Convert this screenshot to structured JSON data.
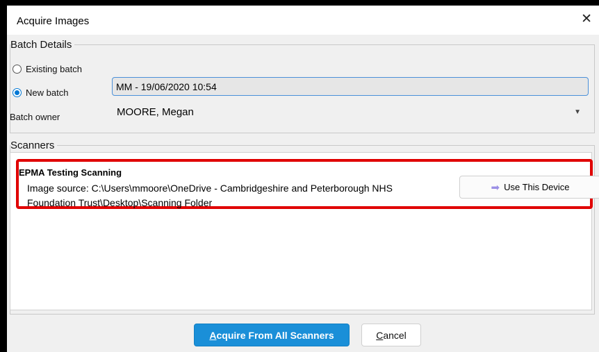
{
  "window": {
    "title": "Acquire Images",
    "close_glyph": "✕"
  },
  "batch_details": {
    "legend": "Batch Details",
    "existing_batch_label": "Existing batch",
    "new_batch_label": "New batch",
    "new_batch_selected": true,
    "batch_name_value": "MM - 19/06/2020 10:54",
    "batch_owner_label": "Batch owner",
    "batch_owner_value": "MOORE, Megan"
  },
  "scanners": {
    "legend": "Scanners",
    "devices": [
      {
        "name": "EPMA Testing Scanning",
        "source": "Image source: C:\\Users\\mmoore\\OneDrive - Cambridgeshire and Peterborough NHS Foundation Trust\\Desktop\\Scanning Folder",
        "use_button_label": "Use This Device",
        "highlighted": true,
        "highlight_color": "#e00000"
      }
    ]
  },
  "footer": {
    "acquire_first": "A",
    "acquire_rest": "cquire From All Scanners",
    "cancel_first": "C",
    "cancel_rest": "ancel"
  },
  "colors": {
    "accent": "#1a8fd8",
    "highlight": "#e00000",
    "arrow": "#9b8fe6"
  },
  "icons": {
    "close": "close-icon",
    "dropdown": "chevron-down-icon",
    "use_device": "arrow-right-icon"
  }
}
